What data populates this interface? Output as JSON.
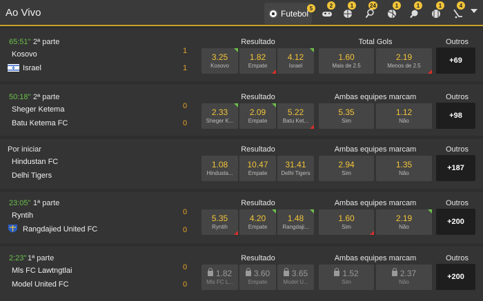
{
  "header": {
    "title": "Ao Vivo",
    "sport_tab": "Futebol",
    "sports": [
      {
        "icon": "soccer-ball-icon",
        "badge": "5"
      },
      {
        "icon": "gamepad-icon",
        "badge": "2"
      },
      {
        "icon": "basketball-icon",
        "badge": "1"
      },
      {
        "icon": "tennis-icon",
        "badge": "24"
      },
      {
        "icon": "volleyball-icon",
        "badge": "1"
      },
      {
        "icon": "table-tennis-icon",
        "badge": "1"
      },
      {
        "icon": "handball-icon",
        "badge": "1"
      },
      {
        "icon": "hockey-icon",
        "badge": "4"
      }
    ]
  },
  "matches": [
    {
      "time": "65:51\"",
      "period": "2ª parte",
      "home": "Kosovo",
      "away": "Israel",
      "home_score": "1",
      "away_score": "1",
      "market1": "Resultado",
      "market2": "Total Gols",
      "odds": [
        {
          "value": "3.25",
          "label": "Kosovo",
          "trend": "up"
        },
        {
          "value": "1.82",
          "label": "Empate",
          "trend": "down"
        },
        {
          "value": "4.12",
          "label": "Israel",
          "trend": "up"
        },
        {
          "value": "1.60",
          "label": "Mais de 2.5",
          "trend": ""
        },
        {
          "value": "2.19",
          "label": "Menos de 2.5",
          "trend": "down"
        }
      ],
      "outros": "Outros",
      "more": "+69"
    },
    {
      "time": "50:18\"",
      "period": "2ª parte",
      "home": "Sheger Ketema",
      "away": "Batu Ketema FC",
      "home_score": "0",
      "away_score": "0",
      "market1": "Resultado",
      "market2": "Ambas equipes marcam",
      "odds": [
        {
          "value": "2.33",
          "label": "Sheger K...",
          "trend": "up"
        },
        {
          "value": "2.09",
          "label": "Empate",
          "trend": "up"
        },
        {
          "value": "5.22",
          "label": "Batu Ket...",
          "trend": "down"
        },
        {
          "value": "5.35",
          "label": "Sim",
          "trend": ""
        },
        {
          "value": "1.12",
          "label": "Não",
          "trend": ""
        }
      ],
      "outros": "Outros",
      "more": "+98"
    },
    {
      "time": "",
      "period": "Por iniciar",
      "home": "Hindustan FC",
      "away": "Delhi Tigers",
      "home_score": "",
      "away_score": "",
      "market1": "Resultado",
      "market2": "Ambas equipes marcam",
      "odds": [
        {
          "value": "1.08",
          "label": "Hindusta...",
          "trend": ""
        },
        {
          "value": "10.47",
          "label": "Empate",
          "trend": ""
        },
        {
          "value": "31.41",
          "label": "Delhi Tigers",
          "trend": ""
        },
        {
          "value": "2.94",
          "label": "Sim",
          "trend": ""
        },
        {
          "value": "1.35",
          "label": "Não",
          "trend": ""
        }
      ],
      "outros": "Outros",
      "more": "+187"
    },
    {
      "time": "23:05\"",
      "period": "1ª parte",
      "home": "Ryntih",
      "away": "Rangdajied United FC",
      "home_score": "0",
      "away_score": "0",
      "market1": "Resultado",
      "market2": "Ambas equipes marcam",
      "odds": [
        {
          "value": "5.35",
          "label": "Ryntih",
          "trend": "down"
        },
        {
          "value": "4.20",
          "label": "Empate",
          "trend": "up"
        },
        {
          "value": "1.48",
          "label": "Rangdaji...",
          "trend": "up"
        },
        {
          "value": "1.60",
          "label": "Sim",
          "trend": "down"
        },
        {
          "value": "2.19",
          "label": "Não",
          "trend": "up"
        }
      ],
      "outros": "Outros",
      "more": "+200"
    },
    {
      "time": "2:23\"",
      "period": "1ª parte",
      "home": "Mls FC Lawtngtlai",
      "away": "Model United FC",
      "home_score": "0",
      "away_score": "0",
      "market1": "Resultado",
      "market2": "Ambas equipes marcam",
      "odds": [
        {
          "value": "1.82",
          "label": "Mls FC L...",
          "trend": "",
          "locked": true
        },
        {
          "value": "3.60",
          "label": "Empate",
          "trend": "",
          "locked": true
        },
        {
          "value": "3.65",
          "label": "Model U...",
          "trend": "",
          "locked": true
        },
        {
          "value": "1.52",
          "label": "Sim",
          "trend": "",
          "locked": true
        },
        {
          "value": "2.37",
          "label": "Não",
          "trend": "",
          "locked": true
        }
      ],
      "outros": "Outros",
      "more": "+200"
    }
  ]
}
